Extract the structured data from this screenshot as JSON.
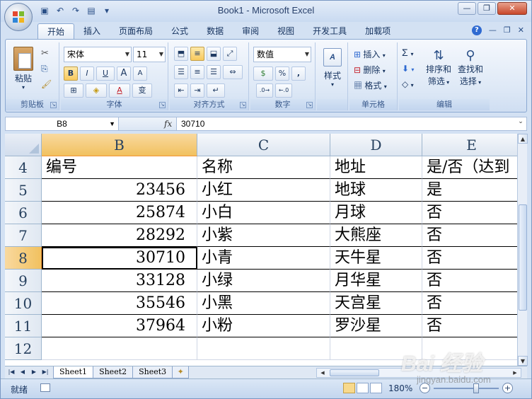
{
  "window": {
    "title": "Book1 - Microsoft Excel"
  },
  "qat": {
    "save": "💾",
    "undo": "↶",
    "redo": "↷",
    "preview": "🔍",
    "customize": "▾"
  },
  "tabs": [
    "开始",
    "插入",
    "页面布局",
    "公式",
    "数据",
    "审阅",
    "视图",
    "开发工具",
    "加载项"
  ],
  "ribbon": {
    "clipboard": {
      "label": "剪贴板",
      "paste": "粘贴"
    },
    "font": {
      "label": "字体",
      "name": "宋体",
      "size": "11",
      "bold": "B",
      "italic": "I",
      "underline": "U",
      "grow": "A",
      "shrink": "A",
      "wen": "变"
    },
    "alignment": {
      "label": "对齐方式"
    },
    "number": {
      "label": "数字",
      "format": "数值",
      "percent": "%",
      "comma": ",",
      "inc": ".0 .00",
      "dec": ".00 .0"
    },
    "styles": {
      "label": "样式"
    },
    "cells": {
      "label": "单元格",
      "insert": "插入",
      "delete": "删除",
      "format": "格式"
    },
    "editing": {
      "label": "编辑",
      "sigma": "Σ",
      "sort": "排序和",
      "sort2": "筛选",
      "find": "查找和",
      "find2": "选择"
    }
  },
  "formula_bar": {
    "name_box": "B8",
    "fx": "fx",
    "value": "30710"
  },
  "columns": [
    "B",
    "C",
    "D",
    "E"
  ],
  "rows": [
    {
      "num": "4",
      "b": "编号",
      "c": "名称",
      "d": "地址",
      "e": "是/否（达到"
    },
    {
      "num": "5",
      "b": "23456",
      "c": "小红",
      "d": "地球",
      "e": "是"
    },
    {
      "num": "6",
      "b": "25874",
      "c": "小白",
      "d": "月球",
      "e": "否"
    },
    {
      "num": "7",
      "b": "28292",
      "c": "小紫",
      "d": "大熊座",
      "e": "否"
    },
    {
      "num": "8",
      "b": "30710",
      "c": "小青",
      "d": "天牛星",
      "e": "否"
    },
    {
      "num": "9",
      "b": "33128",
      "c": "小绿",
      "d": "月华星",
      "e": "否"
    },
    {
      "num": "10",
      "b": "35546",
      "c": "小黑",
      "d": "天宫星",
      "e": "否"
    },
    {
      "num": "11",
      "b": "37964",
      "c": "小粉",
      "d": "罗沙星",
      "e": "否"
    },
    {
      "num": "12",
      "b": "",
      "c": "",
      "d": "",
      "e": ""
    }
  ],
  "sheets": [
    "Sheet1",
    "Sheet2",
    "Sheet3"
  ],
  "status": {
    "ready": "就绪",
    "zoom": "180%"
  },
  "watermark": {
    "main": "Bai 经验",
    "sub": "jingyan.baidu.com"
  }
}
